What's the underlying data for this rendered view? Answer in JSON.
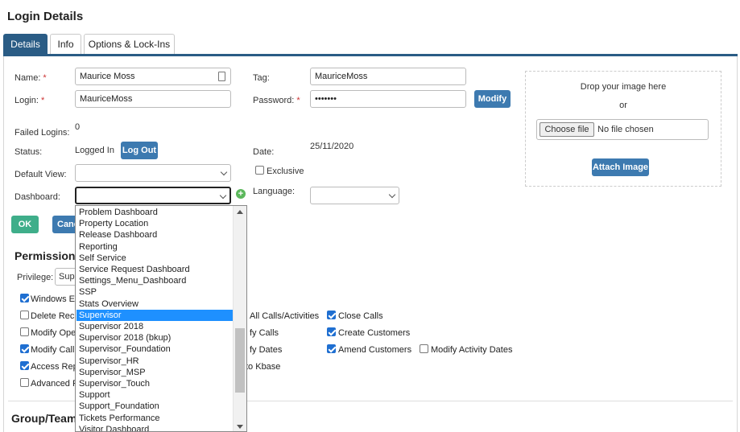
{
  "page": {
    "title": "Login Details"
  },
  "tabs": [
    {
      "label": "Details",
      "active": true
    },
    {
      "label": "Info",
      "active": false
    },
    {
      "label": "Options & Lock-Ins",
      "active": false
    }
  ],
  "form": {
    "name_label": "Name:",
    "name_value": "Maurice Moss",
    "login_label": "Login:",
    "login_value": "MauriceMoss",
    "tag_label": "Tag:",
    "tag_value": "MauriceMoss",
    "password_label": "Password:",
    "password_value": "•••••••",
    "required_mark": "*",
    "modify_button": "Modify",
    "failed_logins_label": "Failed Logins:",
    "failed_logins_value": "0",
    "status_label": "Status:",
    "status_value": "Logged In",
    "logout_button": "Log Out",
    "date_label": "Date:",
    "date_value": "25/11/2020",
    "default_view_label": "Default View:",
    "default_view_value": "",
    "exclusive_label": "Exclusive",
    "dashboard_label": "Dashboard:",
    "dashboard_value": "",
    "language_label": "Language:",
    "language_value": "",
    "ok_button": "OK",
    "cancel_button": "Canc"
  },
  "image": {
    "drop_text": "Drop your image here",
    "or_text": "or",
    "choose_file_button": "Choose file",
    "no_file_text": "No file chosen",
    "attach_button": "Attach Image"
  },
  "permissions": {
    "title": "Permissions",
    "privilege_label": "Privilege:",
    "privilege_value": "Sup",
    "items": [
      {
        "label": "Windows E",
        "checked": true
      },
      {
        "label": "Delete Rec",
        "checked": false
      },
      {
        "label": "Modify Ope",
        "checked": false
      },
      {
        "label": "Modify Call",
        "checked": true
      },
      {
        "label": "Access Rep",
        "checked": true
      },
      {
        "label": "Advanced F",
        "checked": false
      },
      {
        "label": "All Calls/Activities"
      },
      {
        "label": "fy Calls"
      },
      {
        "label": "fy Dates"
      },
      {
        "label": "to Kbase"
      },
      {
        "label": "Close Calls",
        "checked": true
      },
      {
        "label": "Create Customers",
        "checked": true
      },
      {
        "label": "Amend Customers",
        "checked": true
      },
      {
        "label": "Modify Activity Dates",
        "checked": false
      }
    ]
  },
  "group": {
    "title": "Group/Team"
  },
  "dashboard_dropdown": {
    "selected": "Supervisor",
    "options": [
      "Problem Dashboard",
      "Property Location",
      "Release Dashboard",
      "Reporting",
      "Self Service",
      "Service Request Dashboard",
      "Settings_Menu_Dashboard",
      "SSP",
      "Stats Overview",
      "Supervisor",
      "Supervisor 2018",
      "Supervisor 2018 (bkup)",
      "Supervisor_Foundation",
      "Supervisor_HR",
      "Supervisor_MSP",
      "Supervisor_Touch",
      "Support",
      "Support_Foundation",
      "Tickets Performance",
      "Visitor Dashboard"
    ]
  },
  "colors": {
    "accent": "#2a5c85",
    "button": "#3d7ab0",
    "ok": "#3fae8a",
    "selection": "#1e90ff"
  }
}
